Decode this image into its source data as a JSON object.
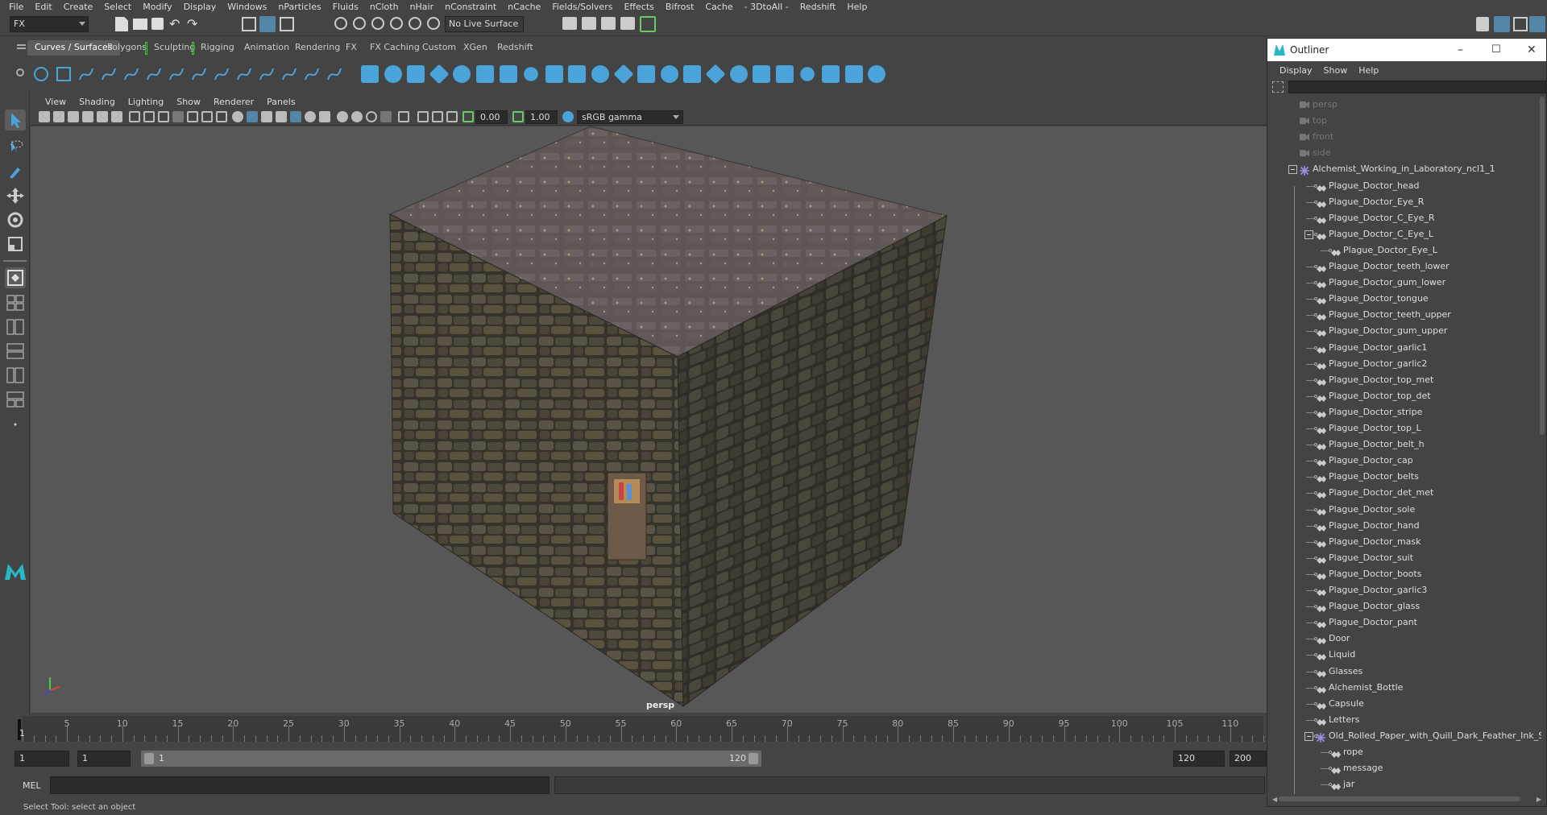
{
  "menubar": [
    "File",
    "Edit",
    "Create",
    "Select",
    "Modify",
    "Display",
    "Windows",
    "nParticles",
    "Fluids",
    "nCloth",
    "nHair",
    "nConstraint",
    "nCache",
    "Fields/Solvers",
    "Effects",
    "Bifrost",
    "Cache",
    "- 3DtoAll -",
    "Redshift",
    "Help"
  ],
  "statusline": {
    "menuset": "FX",
    "live_surface": "No Live Surface"
  },
  "shelf_tabs": [
    "Curves / Surfaces",
    "Polygons",
    "Sculpting",
    "Rigging",
    "Animation",
    "Rendering",
    "FX",
    "FX Caching",
    "Custom",
    "XGen",
    "Redshift"
  ],
  "active_shelf": "Curves / Surfaces",
  "panel_menu": [
    "View",
    "Shading",
    "Lighting",
    "Show",
    "Renderer",
    "Panels"
  ],
  "panel_toolbar": {
    "exposure": "0.00",
    "gamma": "1.00",
    "colorspace": "sRGB gamma"
  },
  "viewport": {
    "camera_label": "persp"
  },
  "timeline": {
    "ticks": [
      5,
      10,
      15,
      20,
      25,
      30,
      35,
      40,
      45,
      50,
      55,
      60,
      65,
      70,
      75,
      80,
      85,
      90,
      95,
      100,
      105,
      110
    ],
    "current_frame": "1"
  },
  "range": {
    "start": "1",
    "playback_start": "1",
    "range_start_label": "1",
    "range_end_label": "120",
    "playback_end": "120",
    "end": "200"
  },
  "command_line": {
    "label": "MEL"
  },
  "help_line": "Select Tool: select an object",
  "outliner": {
    "title": "Outliner",
    "menu": [
      "Display",
      "Show",
      "Help"
    ],
    "items": [
      {
        "label": "persp",
        "type": "camera",
        "depth": 1,
        "dim": true
      },
      {
        "label": "top",
        "type": "camera",
        "depth": 1,
        "dim": true
      },
      {
        "label": "front",
        "type": "camera",
        "depth": 1,
        "dim": true
      },
      {
        "label": "side",
        "type": "camera",
        "depth": 1,
        "dim": true
      },
      {
        "label": "Alchemist_Working_in_Laboratory_ncl1_1",
        "type": "group",
        "depth": 1,
        "expanded": true
      },
      {
        "label": "Plague_Doctor_head",
        "type": "mesh",
        "depth": 2
      },
      {
        "label": "Plague_Doctor_Eye_R",
        "type": "mesh",
        "depth": 2
      },
      {
        "label": "Plague_Doctor_C_Eye_R",
        "type": "mesh",
        "depth": 2
      },
      {
        "label": "Plague_Doctor_C_Eye_L",
        "type": "mesh",
        "depth": 2,
        "expanded": true
      },
      {
        "label": "Plague_Doctor_Eye_L",
        "type": "mesh",
        "depth": 3
      },
      {
        "label": "Plague_Doctor_teeth_lower",
        "type": "mesh",
        "depth": 2
      },
      {
        "label": "Plague_Doctor_gum_lower",
        "type": "mesh",
        "depth": 2
      },
      {
        "label": "Plague_Doctor_tongue",
        "type": "mesh",
        "depth": 2
      },
      {
        "label": "Plague_Doctor_teeth_upper",
        "type": "mesh",
        "depth": 2
      },
      {
        "label": "Plague_Doctor_gum_upper",
        "type": "mesh",
        "depth": 2
      },
      {
        "label": "Plague_Doctor_garlic1",
        "type": "mesh",
        "depth": 2
      },
      {
        "label": "Plague_Doctor_garlic2",
        "type": "mesh",
        "depth": 2
      },
      {
        "label": "Plague_Doctor_top_met",
        "type": "mesh",
        "depth": 2
      },
      {
        "label": "Plague_Doctor_top_det",
        "type": "mesh",
        "depth": 2
      },
      {
        "label": "Plague_Doctor_stripe",
        "type": "mesh",
        "depth": 2
      },
      {
        "label": "Plague_Doctor_top_L",
        "type": "mesh",
        "depth": 2
      },
      {
        "label": "Plague_Doctor_belt_h",
        "type": "mesh",
        "depth": 2
      },
      {
        "label": "Plague_Doctor_cap",
        "type": "mesh",
        "depth": 2
      },
      {
        "label": "Plague_Doctor_belts",
        "type": "mesh",
        "depth": 2
      },
      {
        "label": "Plague_Doctor_det_met",
        "type": "mesh",
        "depth": 2
      },
      {
        "label": "Plague_Doctor_sole",
        "type": "mesh",
        "depth": 2
      },
      {
        "label": "Plague_Doctor_hand",
        "type": "mesh",
        "depth": 2
      },
      {
        "label": "Plague_Doctor_mask",
        "type": "mesh",
        "depth": 2
      },
      {
        "label": "Plague_Doctor_suit",
        "type": "mesh",
        "depth": 2
      },
      {
        "label": "Plague_Doctor_boots",
        "type": "mesh",
        "depth": 2
      },
      {
        "label": "Plague_Doctor_garlic3",
        "type": "mesh",
        "depth": 2
      },
      {
        "label": "Plague_Doctor_glass",
        "type": "mesh",
        "depth": 2
      },
      {
        "label": "Plague_Doctor_pant",
        "type": "mesh",
        "depth": 2
      },
      {
        "label": "Door",
        "type": "mesh",
        "depth": 2
      },
      {
        "label": "Liquid",
        "type": "mesh",
        "depth": 2
      },
      {
        "label": "Glasses",
        "type": "mesh",
        "depth": 2
      },
      {
        "label": "Alchemist_Bottle",
        "type": "mesh",
        "depth": 2
      },
      {
        "label": "Capsule",
        "type": "mesh",
        "depth": 2
      },
      {
        "label": "Letters",
        "type": "mesh",
        "depth": 2
      },
      {
        "label": "Old_Rolled_Paper_with_Quill_Dark_Feather_Ink_Se",
        "type": "group",
        "depth": 2,
        "expanded": true
      },
      {
        "label": "rope",
        "type": "mesh",
        "depth": 3
      },
      {
        "label": "message",
        "type": "mesh",
        "depth": 3
      },
      {
        "label": "jar",
        "type": "mesh",
        "depth": 3
      }
    ]
  },
  "colors": {
    "accent": "#5285a6",
    "shelf_icon": "#4aa3d9",
    "active_tab": "#5d5d5d"
  }
}
